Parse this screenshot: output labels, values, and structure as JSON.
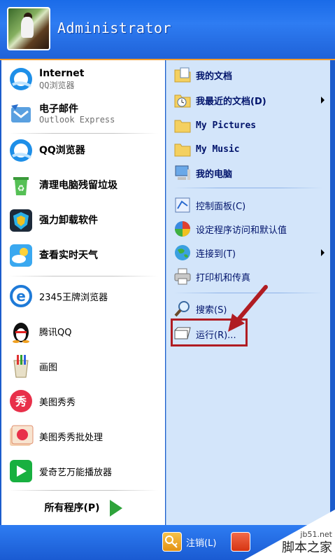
{
  "header": {
    "username": "Administrator"
  },
  "pinned": [
    {
      "label": "Internet",
      "sub": "QQ浏览器",
      "icon": "qq-browser-icon"
    },
    {
      "label": "电子邮件",
      "sub": "Outlook Express",
      "icon": "outlook-express-icon"
    }
  ],
  "recent": [
    {
      "label": "QQ浏览器",
      "icon": "qq-browser-icon"
    },
    {
      "label": "清理电脑残留垃圾",
      "icon": "recycle-bin-icon"
    },
    {
      "label": "强力卸载软件",
      "icon": "uninstall-shield-icon"
    },
    {
      "label": "查看实时天气",
      "icon": "weather-icon"
    },
    {
      "label": "2345王牌浏览器",
      "icon": "ie-browser-icon"
    },
    {
      "label": "腾讯QQ",
      "icon": "qq-penguin-icon"
    },
    {
      "label": "画图",
      "icon": "paint-icon"
    },
    {
      "label": "美图秀秀",
      "icon": "meitu-icon"
    },
    {
      "label": "美图秀秀批处理",
      "icon": "meitu-batch-icon"
    },
    {
      "label": "爱奇艺万能播放器",
      "icon": "iqiyi-player-icon"
    }
  ],
  "all_programs": {
    "label": "所有程序(P)",
    "icon": "green-arrow-icon"
  },
  "right": {
    "my_documents": "我的文档",
    "recent_documents": "我最近的文档(D)",
    "my_pictures": "My Pictures",
    "my_music": "My Music",
    "my_computer": "我的电脑",
    "control_panel": "控制面板(C)",
    "set_program_access": "设定程序访问和默认值",
    "connect_to": "连接到(T)",
    "printers": "打印机和传真",
    "search": "搜索(S)",
    "run": "运行(R)..."
  },
  "bottom": {
    "logoff": "注销(L)"
  },
  "watermark": {
    "url": "jb51.net",
    "name": "脚本之家"
  },
  "colors": {
    "accent": "#1c5ccc",
    "highlight": "#b01c22",
    "right_pane": "#d3e5fa"
  }
}
